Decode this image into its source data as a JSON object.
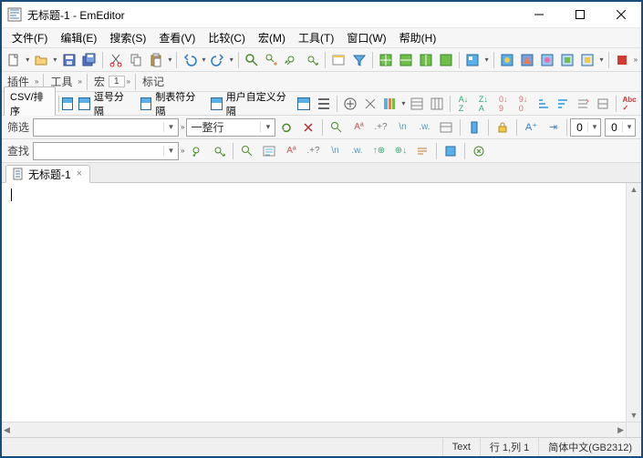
{
  "window": {
    "title": "无标题-1 - EmEditor"
  },
  "menu": {
    "file": "文件(F)",
    "edit": "编辑(E)",
    "search": "搜索(S)",
    "view": "查看(V)",
    "compare": "比较(C)",
    "macro": "宏(M)",
    "tools": "工具(T)",
    "window": "窗口(W)",
    "help": "帮助(H)"
  },
  "toolbar2": {
    "plugins": "插件",
    "tools": "工具",
    "macro": "宏",
    "macro_num": "1",
    "marks": "标记"
  },
  "csvbar": {
    "csv_sort": "CSV/排序",
    "comma": "逗号分隔",
    "tab": "制表符分隔",
    "user": "用户自定义分隔"
  },
  "filterbar": {
    "label": "筛选",
    "value": "",
    "column_value": "一整行"
  },
  "findbar": {
    "label": "查找",
    "value": ""
  },
  "numbox": {
    "a": "0",
    "b": "0"
  },
  "doc": {
    "tab_title": "无标题-1"
  },
  "status": {
    "mode": "Text",
    "pos": "行 1,列 1",
    "encoding": "简体中文(GB2312)"
  },
  "icons": {
    "new": "new",
    "open": "open",
    "save": "save",
    "saveall": "saveall",
    "cut": "cut",
    "copy": "copy",
    "paste": "paste",
    "undo": "undo",
    "redo": "redo",
    "find": "find",
    "replace": "replace",
    "findprev": "findprev",
    "findnext": "findnext",
    "bookmark": "bookmark",
    "filter": "filter",
    "window1": "window1",
    "window2": "window2",
    "window3": "window3",
    "window4": "window4",
    "blue1": "blue1",
    "blue2": "blue2",
    "blue3": "blue3",
    "blue4": "blue4",
    "blue5": "blue5",
    "stop": "stop"
  }
}
